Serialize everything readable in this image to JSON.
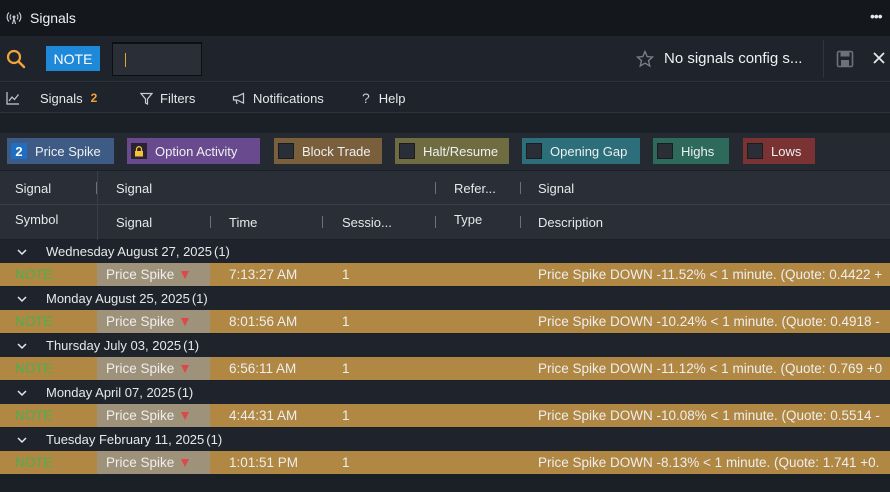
{
  "window": {
    "title": "Signals"
  },
  "toolbar": {
    "symbol": "NOTE",
    "config_text": "No signals config s..."
  },
  "tabs": [
    {
      "label": "Signals",
      "count": "2"
    },
    {
      "label": "Filters"
    },
    {
      "label": "Notifications"
    },
    {
      "label": "Help"
    }
  ],
  "filter_chips": [
    {
      "label": "Price Spike",
      "badge": "2",
      "color": "#3d5b85"
    },
    {
      "label": "Option Activity",
      "color": "#6a4a8e"
    },
    {
      "label": "Block Trade",
      "color": "#7a5f3c"
    },
    {
      "label": "Halt/Resume",
      "color": "#6f6c42"
    },
    {
      "label": "Opening Gap",
      "color": "#2c6e79"
    },
    {
      "label": "Highs",
      "color": "#2d6a5b"
    },
    {
      "label": "Lows",
      "color": "#7a3232"
    }
  ],
  "columns": {
    "row1": [
      "Signal",
      "Signal",
      "Refer...",
      "Signal"
    ],
    "row2": [
      "Symbol",
      "Signal",
      "Time",
      "Sessio...",
      "Type",
      "Description"
    ]
  },
  "groups": [
    {
      "date": "Wednesday August 27, 2025",
      "count": "(1)",
      "row": {
        "symbol": "NOTE",
        "signal": "Price Spike",
        "time": "7:13:27 AM",
        "session": "1",
        "description": "Price Spike DOWN -11.52% < 1 minute. (Quote: 0.4422 +"
      }
    },
    {
      "date": "Monday August 25, 2025",
      "count": "(1)",
      "row": {
        "symbol": "NOTE",
        "signal": "Price Spike",
        "time": "8:01:56 AM",
        "session": "1",
        "description": "Price Spike DOWN -10.24% < 1 minute. (Quote: 0.4918 -"
      }
    },
    {
      "date": "Thursday July 03, 2025",
      "count": "(1)",
      "row": {
        "symbol": "NOTE",
        "signal": "Price Spike",
        "time": "6:56:11 AM",
        "session": "1",
        "description": "Price Spike DOWN -11.12% < 1 minute. (Quote: 0.769 +0"
      }
    },
    {
      "date": "Monday April 07, 2025",
      "count": "(1)",
      "row": {
        "symbol": "NOTE",
        "signal": "Price Spike",
        "time": "4:44:31 AM",
        "session": "1",
        "description": "Price Spike DOWN -10.08% < 1 minute. (Quote: 0.5514 -"
      }
    },
    {
      "date": "Tuesday February 11, 2025",
      "count": "(1)",
      "row": {
        "symbol": "NOTE",
        "signal": "Price Spike",
        "time": "1:01:51 PM",
        "session": "1",
        "description": "Price Spike DOWN -8.13% < 1 minute. (Quote: 1.741 +0."
      }
    }
  ],
  "colors": {
    "accent": "#1e88d9",
    "row_highlight": "#b08743",
    "symbol_text": "#4caf50",
    "down_arrow": "#e04848",
    "tab_count": "#f2a33a"
  },
  "icons": [
    "radio-tower-icon",
    "more-icon",
    "search-icon",
    "star-icon",
    "save-icon",
    "close-icon",
    "chart-line-icon",
    "funnel-icon",
    "megaphone-icon",
    "question-icon",
    "lock-icon",
    "chevron-down-icon",
    "arrow-down-icon"
  ]
}
